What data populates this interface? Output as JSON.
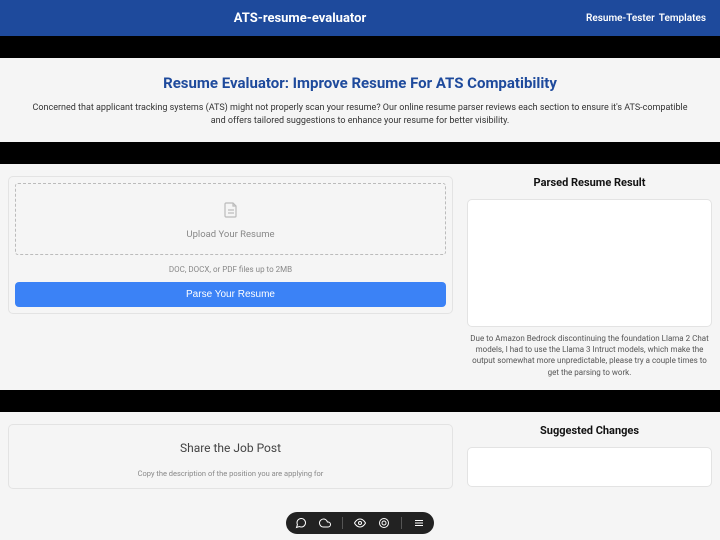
{
  "topbar": {
    "title": "ATS-resume-evaluator",
    "links": [
      {
        "label": "Resume-Tester"
      },
      {
        "label": "Templates"
      }
    ]
  },
  "hero": {
    "title": "Resume Evaluator: Improve Resume For ATS Compatibility",
    "desc": "Concerned that applicant tracking systems (ATS) might not properly scan your resume? Our online resume parser reviews each section to ensure it's ATS-compatible and offers tailored suggestions to enhance your resume for better visibility."
  },
  "upload": {
    "dropzone_text": "Upload Your Resume",
    "file_hint": "DOC, DOCX, or PDF files up to 2MB",
    "button": "Parse Your Resume"
  },
  "parsed": {
    "heading": "Parsed Resume Result",
    "disclaimer": "Due to Amazon Bedrock discontinuing the foundation Llama 2 Chat models, I had to use the Llama 3 Intruct models, which make the output somewhat more unpredictable, please try a couple times to get the parsing to work."
  },
  "jobpost": {
    "title": "Share the Job Post",
    "hint": "Copy the description of the position you are applying for"
  },
  "suggested": {
    "heading": "Suggested Changes"
  }
}
